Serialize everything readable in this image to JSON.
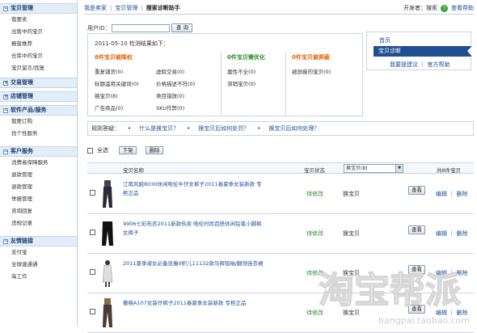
{
  "sidebar": [
    {
      "title": "宝贝管理",
      "items": [
        "我要卖",
        "出售中的宝贝",
        "橱窗推荐",
        "仓库中的宝贝",
        "宝贝留言/回复"
      ]
    },
    {
      "title": "交易管理",
      "items": []
    },
    {
      "title": "店铺管理",
      "items": []
    },
    {
      "title": "软件产品/服务",
      "items": [
        "我要订购",
        "找个性服务"
      ]
    },
    {
      "title": "客户服务",
      "items": [
        "消费者保障服务",
        "退款管理",
        "退款管理",
        "举报管理",
        "咨询回复",
        "违规记录"
      ]
    },
    {
      "title": "友情链接",
      "items": [
        "支付宝",
        "全球速通通",
        "淘工作"
      ]
    }
  ],
  "topbar": {
    "crumbs": [
      "我是卖家",
      "宝贝管理",
      "搜索诊断助手"
    ],
    "dev": "开发者：搜索",
    "help": "查看帮助"
  },
  "search": {
    "label": "用户ID：",
    "value": "",
    "button": "查 询"
  },
  "result": {
    "date": "2011-05-10 检测结果如下：",
    "col1_title": "8件宝贝被降权",
    "col1_items": [
      [
        "重复铺货(0)",
        "虚假交易(0)"
      ],
      [
        "标题滥用关键词(0)",
        "价格描述不符(0)"
      ],
      [
        "换宝贝(8)",
        "类目错放(0)"
      ],
      [
        "广告商品(0)",
        "SKU作弊(0)"
      ]
    ],
    "col2_title": "0件宝贝需优化",
    "col2_items": [
      "属性不全(0)",
      "滞销宝贝(0)"
    ],
    "col3_title": "0件宝贝被屏蔽",
    "col3_items": [
      "被屏蔽的宝贝(0)"
    ]
  },
  "rightnav": {
    "top": "首页",
    "active": "宝贝诊断",
    "links": "我要提建议 ｜ 官方帮助"
  },
  "faq": {
    "label": "规则答疑：",
    "items": [
      "什么是换宝贝？",
      "换宝贝后如何处罚？",
      "换宝贝后如何处理？"
    ]
  },
  "toolbar": {
    "all": "全选",
    "btn1": "下架",
    "btn2": "删除"
  },
  "table": {
    "headers": {
      "name": "宝贝名称",
      "status": "宝贝状态",
      "count": "共8件宝贝"
    },
    "filter": "换宝贝(8)",
    "rows": [
      {
        "title": "江南风姐8030休闲哈伦牛仔女裤子2011春夏季女装新款 专柜正品",
        "status": "待修改",
        "type": "换宝贝",
        "view": "查看",
        "edit": "编辑 ｜ 删除"
      },
      {
        "title": "9906七彩布衣2011新款热卖 哈伦时尚百搭休闲铅笔小脚裤 女裤子",
        "status": "待修改",
        "type": "换宝贝",
        "view": "查看",
        "edit": "编辑 ｜ 删除"
      },
      {
        "title": "2011夏季淑女必备显瘦0织儿11132款马裤短袖/翻领连衣裙",
        "status": "待修改",
        "type": "换宝贝",
        "view": "查看",
        "edit": "编辑 ｜ 删除"
      },
      {
        "title": "撒格A107女装仔裤子2011春夏季女装新款 专柜正品",
        "status": "待修改",
        "type": "换宝贝",
        "view": "查看",
        "edit": "编辑 ｜ 删除"
      }
    ]
  },
  "watermark": {
    "text": "淘宝帮派",
    "url": "bangpai.taobao.com"
  }
}
